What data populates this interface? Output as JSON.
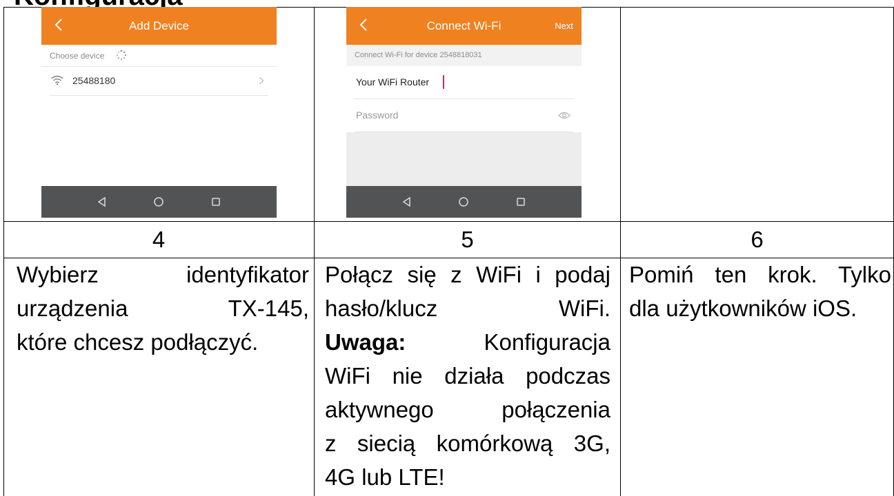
{
  "heading": "Konfiguracja",
  "phones": {
    "add_device": {
      "title": "Add Device",
      "section_label": "Choose device",
      "device_id": "25488180"
    },
    "connect_wifi": {
      "title": "Connect Wi-Fi",
      "next_label": "Next",
      "subtitle": "Connect Wi-Fi for device 2548818031",
      "ssid_value": "Your WiFi Router",
      "password_placeholder": "Password"
    }
  },
  "steps": [
    {
      "number": "4",
      "lines": [
        "Wybierz identyfikator",
        "urządzenia TX-145,",
        "które chcesz podłączyć."
      ]
    },
    {
      "number": "5",
      "lines": [
        "Połącz się z WiFi i podaj",
        "hasło/klucz WiFi."
      ],
      "note_label": "Uwaga:",
      "note_rest": "Konfiguracja",
      "note_lines": [
        "WiFi nie działa podczas",
        "aktywnego połączenia",
        "z siecią komórkową 3G,",
        "4G lub LTE!"
      ]
    },
    {
      "number": "6",
      "lines": [
        "Pomiń ten krok. Tylko",
        "dla użytkowników iOS."
      ]
    }
  ],
  "colors": {
    "accent": "#f08120",
    "navbar": "#515355"
  }
}
